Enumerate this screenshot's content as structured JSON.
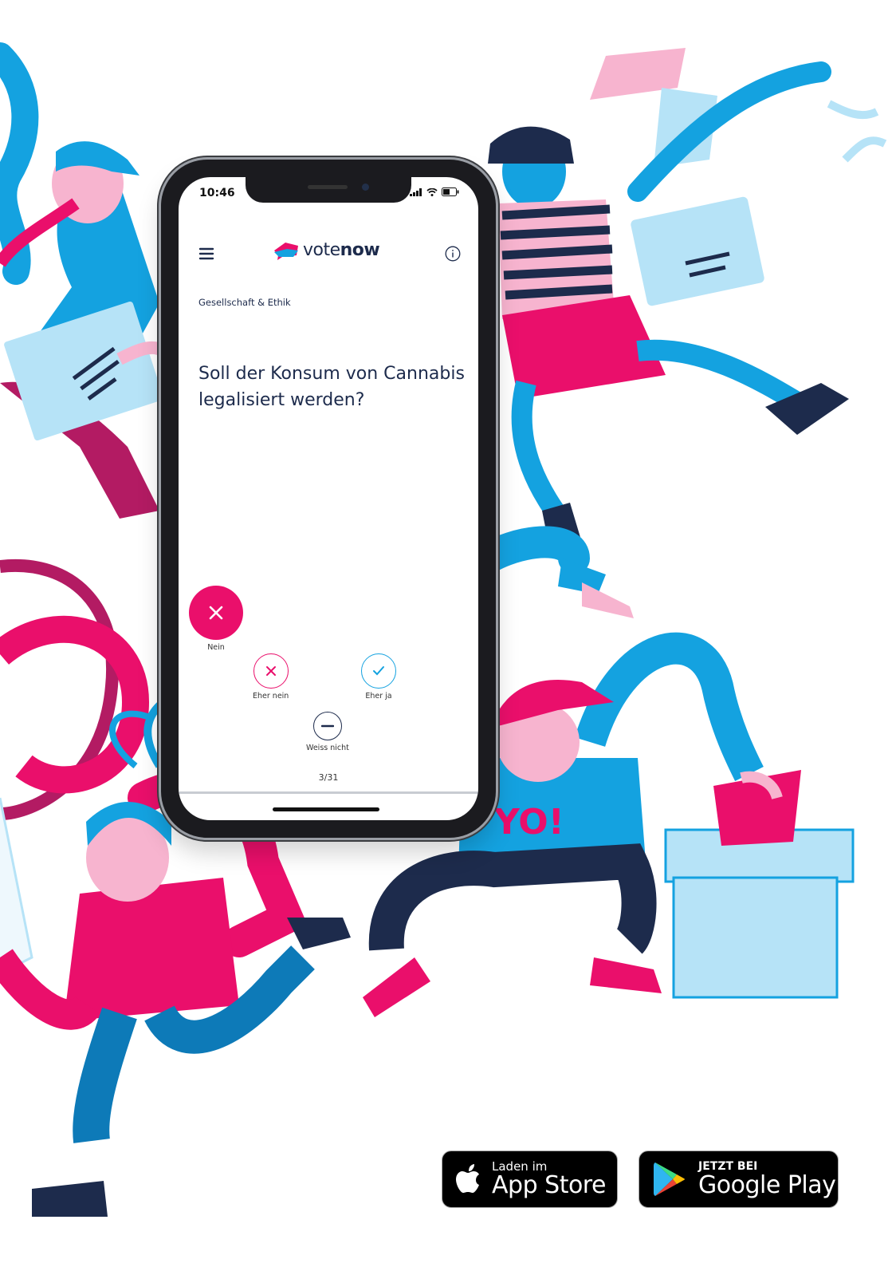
{
  "status_bar": {
    "time": "10:46"
  },
  "app": {
    "logo_prefix": "vote",
    "logo_suffix": "now"
  },
  "question_card": {
    "category": "Gesellschaft & Ethik",
    "question": "Soll der Konsum von Cannabis legalisiert werden?"
  },
  "vote_options": {
    "no": "Nein",
    "rather_no": "Eher nein",
    "rather_yes": "Eher ja",
    "dont_know": "Weiss nicht"
  },
  "progress": {
    "text": "3/31",
    "current": 3,
    "total": 31
  },
  "store_badges": {
    "apple_small": "Laden im",
    "apple_large": "App Store",
    "google_small": "JETZT BEI",
    "google_large": "Google Play"
  },
  "colors": {
    "pink": "#ea0f6b",
    "blue": "#14a2e0",
    "light_blue": "#b6e3f7",
    "light_pink": "#f7b4cf",
    "navy": "#1d2b4c"
  },
  "icons": [
    "menu-icon",
    "info-icon",
    "logo-icon",
    "close-icon",
    "check-icon",
    "minus-icon",
    "apple-icon",
    "google-play-icon"
  ]
}
